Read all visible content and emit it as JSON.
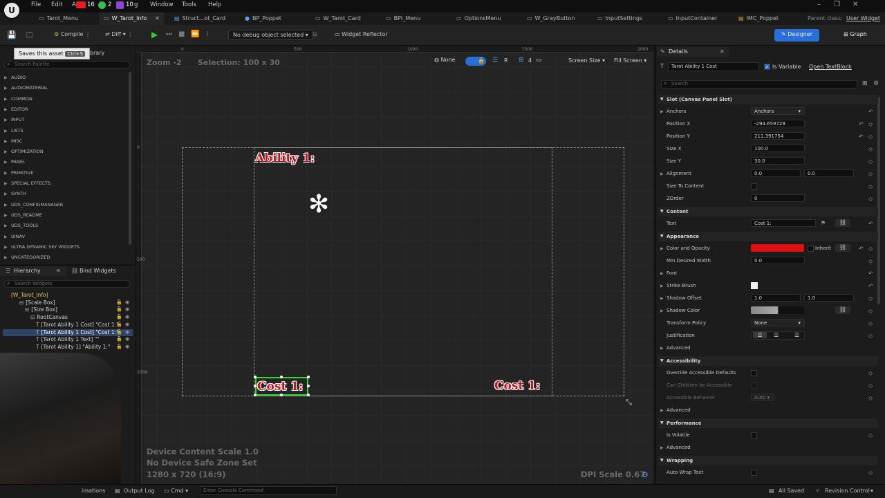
{
  "menu": {
    "items": [
      "File",
      "Edit",
      "Window",
      "Tools",
      "Help"
    ],
    "asset_label": "A",
    "badges": [
      "16",
      "2",
      "10"
    ],
    "badge_tail": "g"
  },
  "tabs": [
    "Tarot_Menu",
    "W_Tarot_Info",
    "Struct...ot_Card",
    "BP_Poppet",
    "W_Tarot_Card",
    "BPI_Menu",
    "OptionsMenu",
    "W_GrayButton",
    "InputSettings",
    "InputContainer",
    "IMC_Poppet"
  ],
  "parent_class": {
    "label": "Parent class:",
    "value": "User Widget"
  },
  "toolbar": {
    "compile": "Compile",
    "diff": "Diff",
    "debug": "No debug object selected",
    "reflector": "Widget Reflector",
    "designer": "Designer",
    "graph": "Graph",
    "tooltip": "Saves this asset",
    "shortcut": "Ctrl+S",
    "library_tail": "brary"
  },
  "palette": {
    "search_placeholder": "Search Palette",
    "categories": [
      "AUDIO",
      "AUDIOMATERIAL",
      "COMMON",
      "EDITOR",
      "INPUT",
      "LISTS",
      "MISC",
      "OPTIMIZATION",
      "PANEL",
      "PRIMITIVE",
      "SPECIAL EFFECTS",
      "SYNTH",
      "UDS_CONFIGMANAGER",
      "UDS_README",
      "UDS_TOOLS",
      "UINAV",
      "ULTRA DYNAMIC SKY WIDGETS",
      "UNCATEGORIZED"
    ]
  },
  "hierarchy": {
    "tab": "Hierarchy",
    "bind_tab": "Bind Widgets",
    "search_placeholder": "Search Widgets",
    "items": [
      "[W_Tarot_Info]",
      "[Scale Box]",
      "[Size Box]",
      "RootCanvas",
      "[Tarot Ability 1 Cost] \"Cost 1:\"",
      "[Tarot Ability 1 Cost] \"Cost 1:\"",
      "[Tarot Ability 1 Text] \"\"",
      "[Tarot Ability 1] \"Ability 1:\""
    ]
  },
  "viewport": {
    "zoom": "Zoom -2",
    "selection": "Selection: 100 x 30",
    "ruler_marks": [
      "0",
      "500",
      "1000",
      "1500",
      "2000"
    ],
    "ruler_v_marks": [
      "0",
      "500",
      "1000"
    ],
    "none_label": "None",
    "r_label": "R",
    "grid_count": "4",
    "screen_size": "Screen Size",
    "fill_screen": "Fill Screen",
    "device_scale": "Device Content Scale 1.0",
    "safe_zone": "No Device Safe Zone Set",
    "resolution": "1280 x 720 (16:9)",
    "dpi": "DPI Scale 0.67",
    "ability_text": "Ability 1:",
    "cost_text": "Cost 1:"
  },
  "details": {
    "title": "Details",
    "widget_name": "Tarot Ability 1 Cost",
    "is_variable": "Is Variable",
    "open": "Open TextBlock",
    "search_placeholder": "Search",
    "sections": {
      "slot": "Slot (Canvas Panel Slot)",
      "content": "Content",
      "appearance": "Appearance",
      "accessibility": "Accessibility",
      "performance": "Performance",
      "wrapping": "Wrapping"
    },
    "props": {
      "anchors": {
        "label": "Anchors",
        "value": "Anchors"
      },
      "pos_x": {
        "label": "Position X",
        "value": "-294.659729"
      },
      "pos_y": {
        "label": "Position Y",
        "value": "211.391754"
      },
      "size_x": {
        "label": "Size X",
        "value": "100.0"
      },
      "size_y": {
        "label": "Size Y",
        "value": "30.0"
      },
      "alignment": {
        "label": "Alignment",
        "value1": "0.0",
        "value2": "0.0"
      },
      "size_to_content": {
        "label": "Size To Content"
      },
      "zorder": {
        "label": "ZOrder",
        "value": "0"
      },
      "text": {
        "label": "Text",
        "value": "Cost 1:"
      },
      "color": {
        "label": "Color and Opacity",
        "inherit": "Inherit",
        "swatch": "#e00d12"
      },
      "min_width": {
        "label": "Min Desired Width",
        "value": "0.0"
      },
      "font": {
        "label": "Font"
      },
      "strike": {
        "label": "Strike Brush"
      },
      "shadow_offset": {
        "label": "Shadow Offset",
        "value1": "1.0",
        "value2": "1.0"
      },
      "shadow_color": {
        "label": "Shadow Color"
      },
      "transform": {
        "label": "Transform Policy",
        "value": "None"
      },
      "justification": {
        "label": "Justification"
      },
      "advanced1": {
        "label": "Advanced"
      },
      "override_access": {
        "label": "Override Accessible Defaults"
      },
      "children_access": {
        "label": "Can Children be Accessible"
      },
      "access_behavior": {
        "label": "Accessible Behavior",
        "value": "Auto"
      },
      "advanced2": {
        "label": "Advanced"
      },
      "is_volatile": {
        "label": "Is Volatile"
      },
      "advanced3": {
        "label": "Advanced"
      },
      "auto_wrap": {
        "label": "Auto Wrap Text"
      }
    }
  },
  "status": {
    "animations": "imations",
    "output_log": "Output Log",
    "cmd": "Cmd",
    "console_placeholder": "Enter Console Command",
    "saved": "All Saved",
    "revision": "Revision Control"
  },
  "colors": {
    "accent": "#2a6fd6",
    "selection_green": "#32d332",
    "text_red": "#c01825"
  }
}
